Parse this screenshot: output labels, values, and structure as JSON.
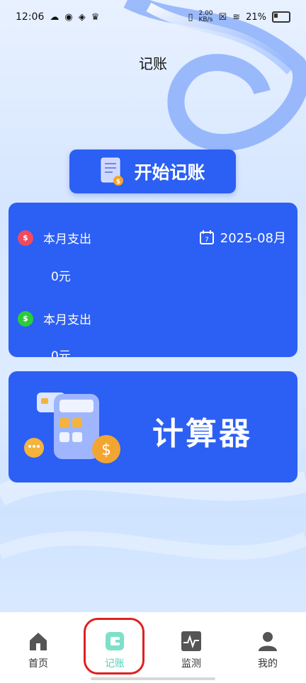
{
  "status_bar": {
    "time": "12:06",
    "net_speed": "2.00\nKB/s",
    "battery": "21%"
  },
  "header": {
    "title": "记账"
  },
  "start_button": {
    "label": "开始记账"
  },
  "summary": {
    "date": "2025-08月",
    "rows": [
      {
        "label": "本月支出",
        "amount": "0元"
      },
      {
        "label": "本月支出",
        "amount": "0元"
      }
    ]
  },
  "calculator": {
    "label": "计算器"
  },
  "tabbar": {
    "tabs": [
      {
        "label": "首页",
        "icon": "home-icon"
      },
      {
        "label": "记账",
        "icon": "wallet-icon"
      },
      {
        "label": "监测",
        "icon": "monitor-icon"
      },
      {
        "label": "我的",
        "icon": "person-icon"
      }
    ],
    "active_color": "#4fd1b8"
  },
  "colors": {
    "primary": "#2c5ff3",
    "highlight": "#e02020"
  }
}
